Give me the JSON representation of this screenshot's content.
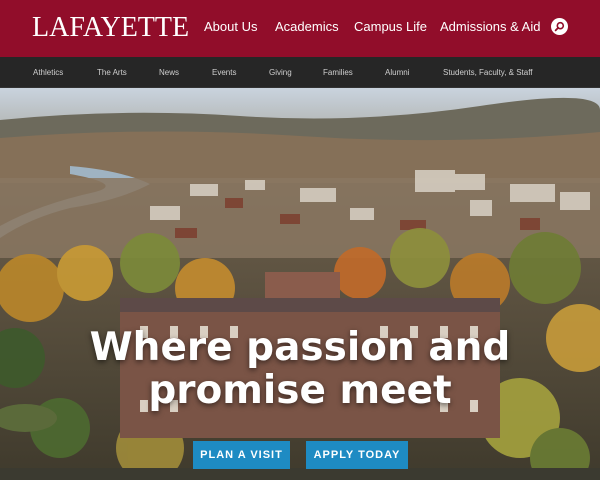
{
  "brand": {
    "logo_text": "LAFAYETTE",
    "color": "#910d2a"
  },
  "main_nav": [
    {
      "label": "About Us"
    },
    {
      "label": "Academics"
    },
    {
      "label": "Campus Life"
    },
    {
      "label": "Admissions & Aid"
    }
  ],
  "search": {
    "icon": "search-icon"
  },
  "sub_nav": [
    {
      "label": "Athletics"
    },
    {
      "label": "The Arts"
    },
    {
      "label": "News"
    },
    {
      "label": "Events"
    },
    {
      "label": "Giving"
    },
    {
      "label": "Families"
    },
    {
      "label": "Alumni"
    },
    {
      "label": "Students, Faculty, & Staff"
    }
  ],
  "hero": {
    "headline_line1": "Where passion and",
    "headline_line2": "promise meet",
    "buttons": [
      {
        "label": "PLAN A VISIT"
      },
      {
        "label": "APPLY TODAY"
      }
    ],
    "button_color": "#1e8bc3"
  }
}
